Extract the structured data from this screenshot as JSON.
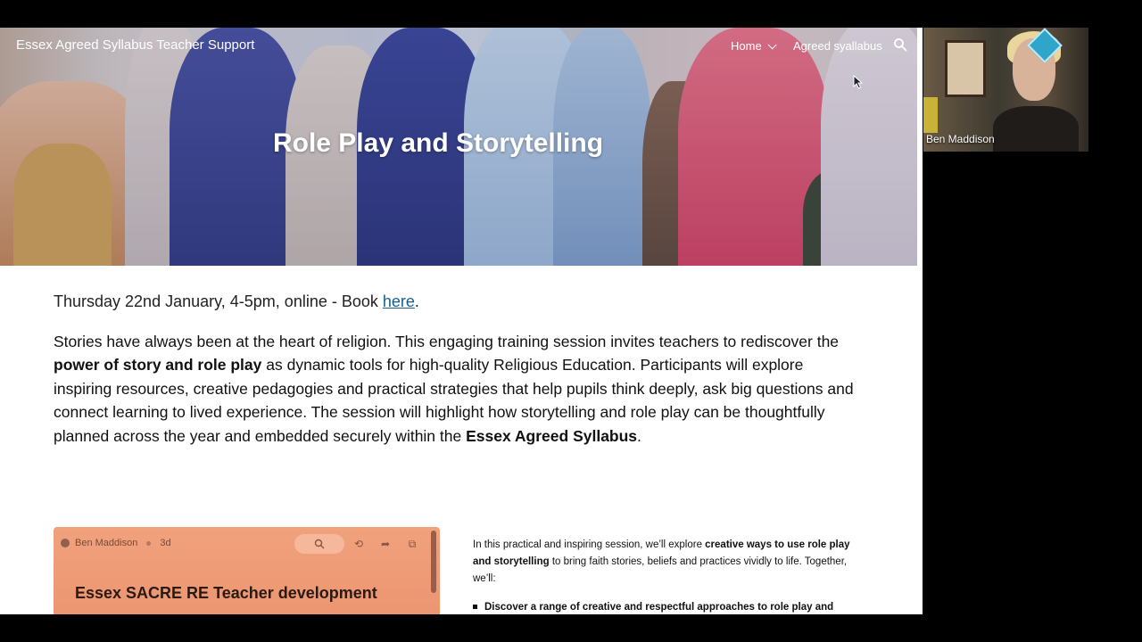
{
  "site": {
    "brand": "Essex Agreed Syllabus Teacher Support",
    "nav": {
      "home": "Home",
      "syllabus": "Agreed syallabus"
    },
    "hero_title": "Role Play and Storytelling"
  },
  "event": {
    "date_text": "Thursday 22nd January, 4-5pm, online - Book ",
    "link_text": "here",
    "period": "."
  },
  "intro": {
    "p1": "Stories have always been at the heart of religion. This engaging training session invites teachers to rediscover the ",
    "b1": "power of story and role play",
    "p2": " as dynamic tools for high-quality Religious Education. Participants will explore inspiring resources, creative pedagogies and practical strategies that help pupils think deeply, ask big questions and connect learning to lived experience. The session will highlight how storytelling and role play can be thoughtfully planned across the year and embedded securely within the ",
    "b2": "Essex Agreed Syllabus",
    "p3": "."
  },
  "card": {
    "author": "Ben Maddison",
    "age": "3d",
    "title": "Essex SACRE RE Teacher development"
  },
  "side": {
    "s1": "In this practical and inspiring session, we’ll explore ",
    "b1": "creative ways to use role play and storytelling",
    "s2": " to bring faith stories, beliefs and practices vividly to life. Together, we’ll:",
    "bullet1": "Discover a range of creative and respectful approaches to role play and"
  },
  "video": {
    "participant": "Ben Maddison"
  },
  "colors": {
    "link": "#1a5c8f",
    "card_bg": "#ec9470",
    "page_bg": "#ffffff"
  }
}
